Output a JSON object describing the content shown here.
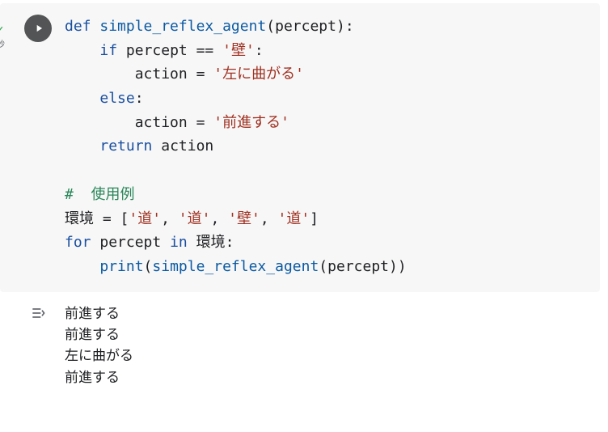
{
  "gutter": {
    "status_char": "✓",
    "seconds_label": "秒"
  },
  "code": {
    "kw_def": "def",
    "fn_name": "simple_reflex_agent",
    "param": "percept",
    "kw_if": "if",
    "cmp_eq": "==",
    "str_wall": "'壁'",
    "var_action": "action",
    "assign": "=",
    "str_turn": "'左に曲がる'",
    "kw_else": "else",
    "str_forward": "'前進する'",
    "kw_return": "return",
    "comment_usage": "#  使用例",
    "var_env": "環境",
    "list_open": "[",
    "list_close": "]",
    "str_road": "'道'",
    "comma": ",",
    "kw_for": "for",
    "kw_in": "in",
    "fn_print": "print",
    "paren_open": "(",
    "paren_close": ")",
    "colon": ":"
  },
  "output": {
    "lines": [
      "前進する",
      "前進する",
      "左に曲がる",
      "前進する"
    ]
  }
}
